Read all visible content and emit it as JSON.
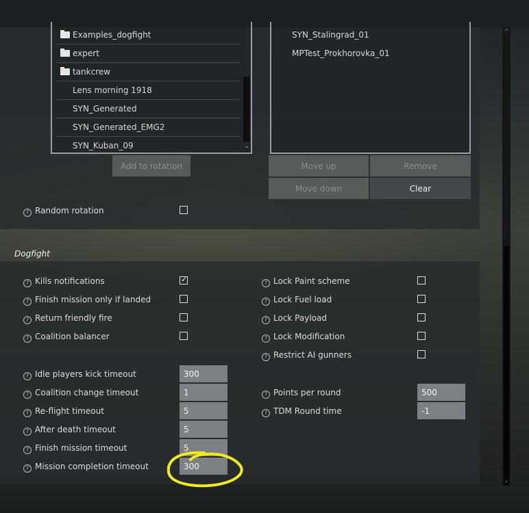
{
  "map_list": {
    "items": [
      {
        "label": "Examples_dogfight",
        "type": "folder"
      },
      {
        "label": "expert",
        "type": "folder"
      },
      {
        "label": "tankcrew",
        "type": "folder"
      },
      {
        "label": "Lens morning 1918",
        "type": "file"
      },
      {
        "label": "SYN_Generated",
        "type": "file"
      },
      {
        "label": "SYN_Generated_EMG2",
        "type": "file"
      },
      {
        "label": "SYN_Kuban_09",
        "type": "file"
      }
    ],
    "add_button": "Add to rotation"
  },
  "rotation_list": {
    "items": [
      "SYN_Stalingrad_01",
      "MPTest_Prokhorovka_01"
    ],
    "buttons": {
      "move_up": "Move up",
      "remove": "Remove",
      "move_down": "Move down",
      "clear": "Clear"
    }
  },
  "random_rotation": {
    "label": "Random rotation",
    "checked": false
  },
  "dogfight": {
    "title": "Dogfight",
    "left_checks": [
      {
        "label": "Kills notifications",
        "checked": true
      },
      {
        "label": "Finish mission only if landed",
        "checked": false
      },
      {
        "label": "Return friendly fire",
        "checked": false
      },
      {
        "label": "Coalition balancer",
        "checked": false
      }
    ],
    "right_checks": [
      {
        "label": "Lock Paint scheme",
        "checked": false
      },
      {
        "label": "Lock Fuel load",
        "checked": false
      },
      {
        "label": "Lock Payload",
        "checked": false
      },
      {
        "label": "Lock Modification",
        "checked": false
      },
      {
        "label": "Restrict AI gunners",
        "checked": false
      }
    ],
    "left_fields": [
      {
        "label": "Idle players kick timeout",
        "value": "300"
      },
      {
        "label": "Coalition change timeout",
        "value": "1"
      },
      {
        "label": "Re-flight timeout",
        "value": "5"
      },
      {
        "label": "After death timeout",
        "value": "5"
      },
      {
        "label": "Finish mission timeout",
        "value": "5"
      },
      {
        "label": "Mission completion timeout",
        "value": "300"
      }
    ],
    "right_fields": [
      {
        "label": "Points per round",
        "value": "500"
      },
      {
        "label": "TDM Round time",
        "value": "-1"
      }
    ]
  },
  "help_glyph": "?",
  "annotation_color": "#f2ea1a"
}
